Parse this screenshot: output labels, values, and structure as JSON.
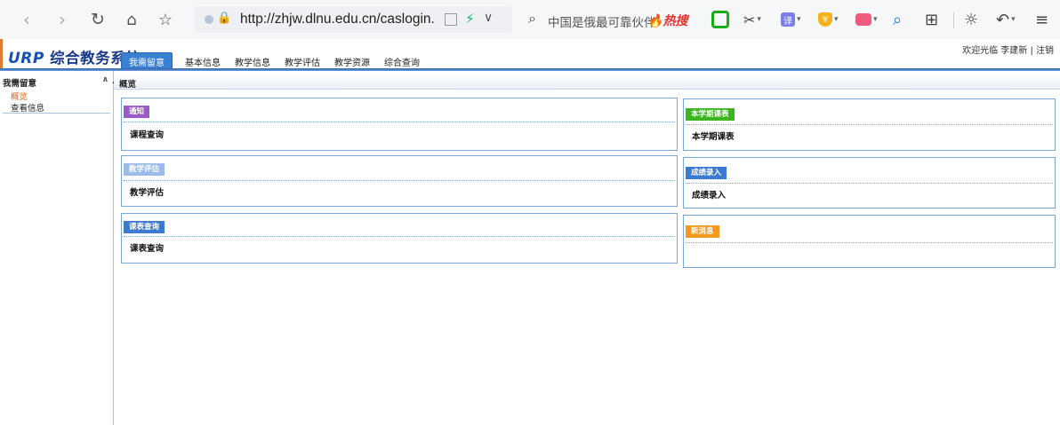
{
  "browser": {
    "url": "http://zhjw.dlnu.edu.cn/caslogin.",
    "search_text": "中国是俄最可靠伙伴",
    "hot_label": "热搜",
    "icons": [
      "back-icon",
      "forward-icon",
      "reload-icon",
      "home-icon",
      "star-icon",
      "search-icon",
      "extension-icons",
      "grid-icon",
      "sun-icon",
      "undo-icon",
      "menu-icon"
    ]
  },
  "app": {
    "logo_prefix": "URP",
    "logo_text": "综合教务系统",
    "welcome": "欢迎光临 李建新 | 注销",
    "tabs": [
      "我需留意",
      "基本信息",
      "教学信息",
      "教学评估",
      "教学资源",
      "综合查询"
    ],
    "active_tab": 0
  },
  "sidebar": {
    "title": "我需留意",
    "items": [
      "概览",
      "查看信息"
    ]
  },
  "breadcrumb": "概览",
  "panels": {
    "p1": {
      "title": "通知",
      "link": "课程查询",
      "color": "#9b59c9"
    },
    "p2": {
      "title": "教学评估",
      "link": "教学评估",
      "color": "#9cbbe9"
    },
    "p3": {
      "title": "课表查询",
      "link": "课表查询",
      "color": "#3b7ad0"
    },
    "p4": {
      "title": "本学期课表",
      "link": "本学期课表",
      "color": "#3cb521"
    },
    "p5": {
      "title": "成绩录入",
      "link": "成绩录入",
      "color": "#3b7ad0"
    },
    "p6": {
      "title": "新消息",
      "link": "",
      "color": "#f39a1e"
    }
  }
}
